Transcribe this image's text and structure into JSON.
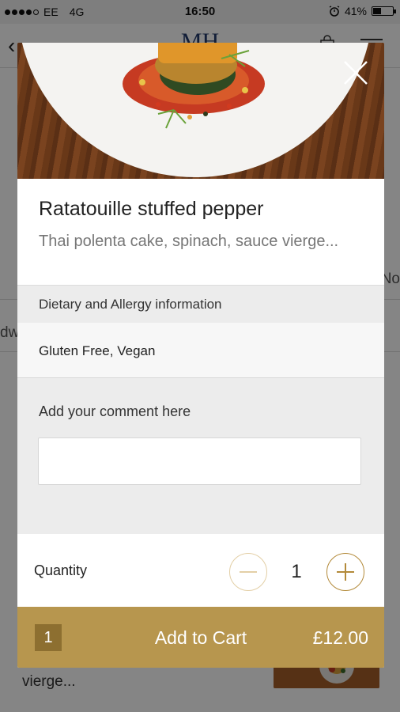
{
  "status_bar": {
    "carrier": "EE",
    "network": "4G",
    "time": "16:50",
    "battery": "41%",
    "battery_level": 0.41
  },
  "background": {
    "logo": "MH",
    "side_right": "No",
    "side_left": "dw",
    "item_description": "Spinach, poached egg, sauce vierge..."
  },
  "modal": {
    "title": "Ratatouille stuffed pepper",
    "description": "Thai polenta cake, spinach, sauce vierge...",
    "dietary_heading": "Dietary and Allergy information",
    "dietary_value": "Gluten Free, Vegan",
    "comment_label": "Add your comment here",
    "comment_value": "",
    "quantity_label": "Quantity",
    "quantity": "1",
    "cart": {
      "count": "1",
      "label": "Add to Cart",
      "price": "£12.00"
    }
  },
  "colors": {
    "accent": "#b7964e",
    "accent_dark": "#8d6f30"
  },
  "icons": [
    "back-icon",
    "bag-icon",
    "menu-icon",
    "close-icon",
    "minus-icon",
    "plus-icon",
    "alarm-icon"
  ]
}
